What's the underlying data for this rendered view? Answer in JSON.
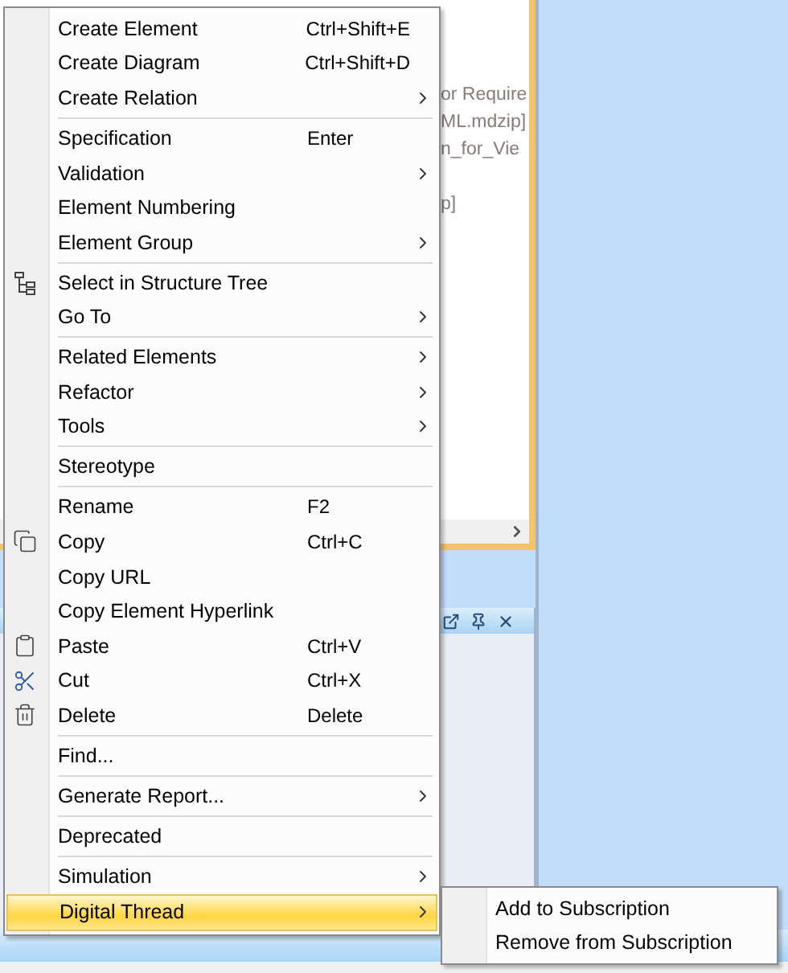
{
  "background_panel": {
    "text_fragments": [
      "or Require",
      "ML.mdzip]",
      "n_for_Vie",
      "p]"
    ]
  },
  "context_menu": {
    "items": [
      {
        "kind": "item",
        "label": "Create Element",
        "shortcut": "Ctrl+Shift+E",
        "submenu": false,
        "selected": false
      },
      {
        "kind": "item",
        "label": "Create Diagram",
        "shortcut": "Ctrl+Shift+D",
        "submenu": false,
        "selected": false
      },
      {
        "kind": "item",
        "label": "Create Relation",
        "submenu": true,
        "selected": false
      },
      {
        "kind": "separator"
      },
      {
        "kind": "item",
        "label": "Specification",
        "shortcut": "Enter",
        "submenu": false,
        "selected": false
      },
      {
        "kind": "item",
        "label": "Validation",
        "submenu": true,
        "selected": false
      },
      {
        "kind": "item",
        "label": "Element Numbering",
        "submenu": false,
        "selected": false
      },
      {
        "kind": "item",
        "label": "Element Group",
        "submenu": true,
        "selected": false
      },
      {
        "kind": "separator"
      },
      {
        "kind": "item",
        "label": "Select in Structure Tree",
        "submenu": false,
        "selected": false
      },
      {
        "kind": "item",
        "label": "Go To",
        "submenu": true,
        "selected": false
      },
      {
        "kind": "separator"
      },
      {
        "kind": "item",
        "label": "Related Elements",
        "submenu": true,
        "selected": false
      },
      {
        "kind": "item",
        "label": "Refactor",
        "submenu": true,
        "selected": false
      },
      {
        "kind": "item",
        "label": "Tools",
        "submenu": true,
        "selected": false
      },
      {
        "kind": "separator"
      },
      {
        "kind": "item",
        "label": "Stereotype",
        "submenu": false,
        "selected": false
      },
      {
        "kind": "separator"
      },
      {
        "kind": "item",
        "label": "Rename",
        "shortcut": "F2",
        "submenu": false,
        "selected": false
      },
      {
        "kind": "item",
        "label": "Copy",
        "shortcut": "Ctrl+C",
        "submenu": false,
        "selected": false
      },
      {
        "kind": "item",
        "label": "Copy URL",
        "submenu": false,
        "selected": false
      },
      {
        "kind": "item",
        "label": "Copy Element Hyperlink",
        "submenu": false,
        "selected": false
      },
      {
        "kind": "item",
        "label": "Paste",
        "shortcut": "Ctrl+V",
        "submenu": false,
        "selected": false
      },
      {
        "kind": "item",
        "label": "Cut",
        "shortcut": "Ctrl+X",
        "submenu": false,
        "selected": false
      },
      {
        "kind": "item",
        "label": "Delete",
        "shortcut": "Delete",
        "submenu": false,
        "selected": false
      },
      {
        "kind": "separator"
      },
      {
        "kind": "item",
        "label": "Find...",
        "submenu": false,
        "selected": false
      },
      {
        "kind": "separator"
      },
      {
        "kind": "item",
        "label": "Generate Report...",
        "submenu": true,
        "selected": false
      },
      {
        "kind": "separator"
      },
      {
        "kind": "item",
        "label": "Deprecated",
        "submenu": false,
        "selected": false
      },
      {
        "kind": "separator"
      },
      {
        "kind": "item",
        "label": "Simulation",
        "submenu": true,
        "selected": false
      },
      {
        "kind": "item",
        "label": "Digital Thread",
        "submenu": true,
        "selected": true
      }
    ]
  },
  "submenu": {
    "items": [
      {
        "label": "Add to Subscription",
        "selected": false
      },
      {
        "label": "Remove from Subscription",
        "selected": false
      }
    ]
  }
}
